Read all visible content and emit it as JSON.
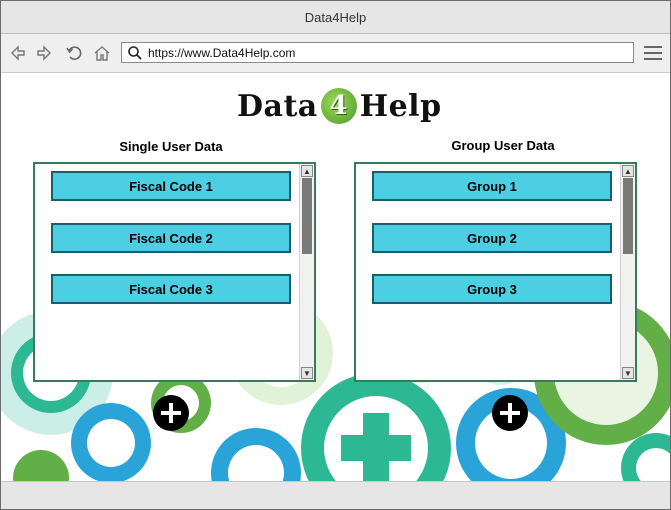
{
  "window": {
    "title": "Data4Help"
  },
  "browser": {
    "url": "https://www.Data4Help.com",
    "icons": [
      "back-arrow-icon",
      "forward-arrow-icon",
      "reload-icon",
      "home-icon",
      "search-icon",
      "menu-icon"
    ]
  },
  "logo": {
    "text_before": "Data",
    "text_number": "4",
    "text_after": "Help"
  },
  "single_user": {
    "title": "Single User Data",
    "items": [
      "Fiscal Code 1",
      "Fiscal Code 2",
      "Fiscal Code 3"
    ]
  },
  "group_user": {
    "title": "Group User Data",
    "items": [
      "Group 1",
      "Group 2",
      "Group 3"
    ]
  },
  "colors": {
    "item_fill": "#4ccfe2",
    "item_border": "#1c5d6b",
    "panel_border": "#3a7a5c",
    "gear_green": "#5aab3e",
    "gear_teal": "#20b58e",
    "gear_blue": "#1f9fd8",
    "gear_light": "#cfeee5"
  }
}
